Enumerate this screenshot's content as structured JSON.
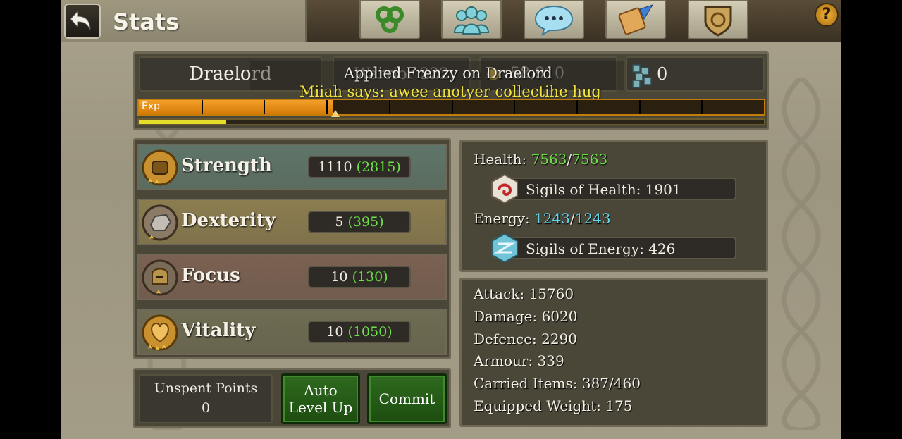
{
  "header": {
    "title": "Stats",
    "back_icon": "back-arrow-icon",
    "nav_icons": [
      "triskele-icon",
      "group-icon",
      "chat-bubble-icon",
      "quest-scroll-icon",
      "guild-shield-icon"
    ],
    "help_label": "?"
  },
  "character": {
    "name": "Draelord",
    "class_level": "Warrior 222",
    "gold": "58,910",
    "gems": "0"
  },
  "overlay": {
    "message": "Applied Frenzy on Draelord",
    "chat": "Miiah says: awee anotyer collectihe hug"
  },
  "exp": {
    "label": "Exp",
    "progress": 0.31,
    "segments": 10,
    "sub_progress": 0.14
  },
  "stats": [
    {
      "name": "Strength",
      "base": "1110",
      "total": "(2815)",
      "icon": "strength-fist-icon",
      "bg": "#5f7569"
    },
    {
      "name": "Dexterity",
      "base": "5",
      "total": "(395)",
      "icon": "dexterity-gauntlet-icon",
      "bg": "#8c7d50"
    },
    {
      "name": "Focus",
      "base": "10",
      "total": "(130)",
      "icon": "focus-helmet-icon",
      "bg": "#7b6152"
    },
    {
      "name": "Vitality",
      "base": "10",
      "total": "(1050)",
      "icon": "vitality-heart-icon",
      "bg": "#6f6c53"
    }
  ],
  "resources": {
    "health_label": "Health:",
    "health_current": "7563",
    "health_max": "7563",
    "sigils_health": "Sigils of Health: 1901",
    "energy_label": "Energy:",
    "energy_current": "1243",
    "energy_max": "1243",
    "sigils_energy": "Sigils of Energy: 426",
    "separator": "/"
  },
  "combat": [
    "Attack: 15760",
    "Damage: 6020",
    "Defence: 2290",
    "Armour: 339",
    "Carried Items: 387/460",
    "Equipped Weight: 175"
  ],
  "footer": {
    "unspent_label": "Unspent Points",
    "unspent_value": "0",
    "auto_level_line1": "Auto",
    "auto_level_line2": "Level Up",
    "commit": "Commit"
  }
}
